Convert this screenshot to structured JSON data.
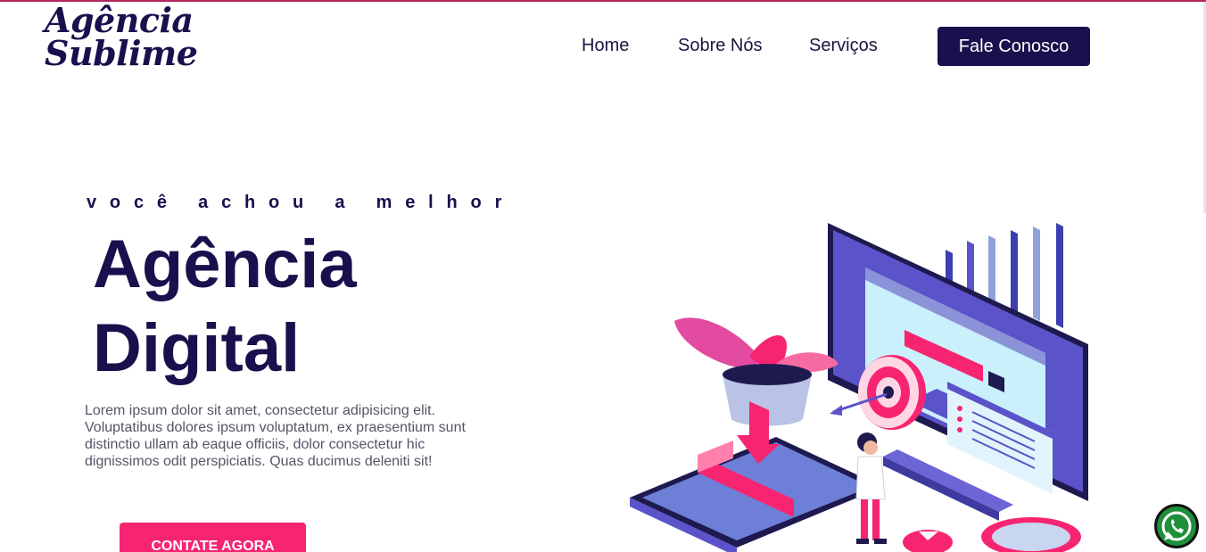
{
  "brand": {
    "logo_line1": "Agência",
    "logo_line2": "Sublime"
  },
  "nav": {
    "items": [
      {
        "label": "Home"
      },
      {
        "label": "Sobre Nós"
      },
      {
        "label": "Serviços"
      }
    ],
    "cta_label": "Fale Conosco"
  },
  "hero": {
    "tagline": "você achou a melhor",
    "title_line1": "Agência",
    "title_line2": "Digital",
    "description": "Lorem ipsum dolor sit amet, consectetur adipisicing elit. Voluptatibus dolores ipsum voluptatum, ex praesentium sunt distinctio ullam ab eaque officiis, dolor consectetur hic dignissimos odit perspiciatis. Quas ducimus deleniti sit!",
    "button_label": "CONTATE AGORA"
  },
  "colors": {
    "brand_dark": "#1b0f4d",
    "accent_pink": "#f72471",
    "top_border": "#b3265e",
    "illustration_purple": "#5b53c9",
    "illustration_blue": "#3f4fb8",
    "whatsapp_green": "#1f8f3a"
  },
  "icons": {
    "illustration": "digital-marketing-illustration",
    "whatsapp": "whatsapp-icon"
  }
}
